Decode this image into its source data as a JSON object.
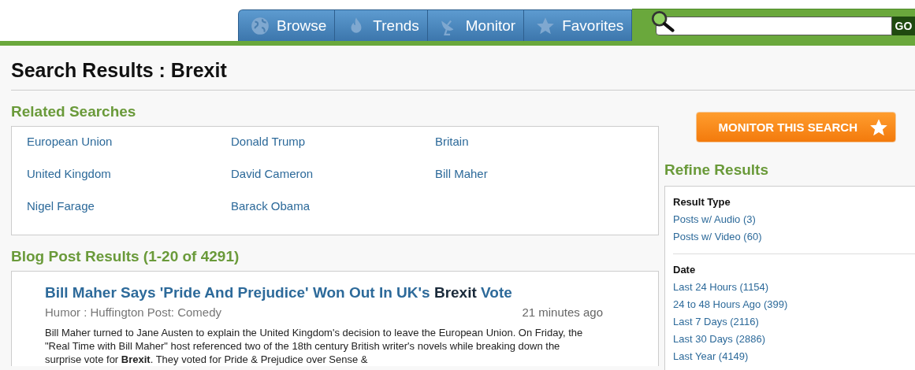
{
  "nav": {
    "tabs": [
      {
        "label": "Browse"
      },
      {
        "label": "Trends"
      },
      {
        "label": "Monitor"
      },
      {
        "label": "Favorites"
      }
    ],
    "search": {
      "button": "GO"
    }
  },
  "page_title": "Search Results : Brexit",
  "related": {
    "heading": "Related Searches",
    "items": [
      "European Union",
      "Donald Trump",
      "Britain",
      "United Kingdom",
      "David Cameron",
      "Bill Maher",
      "Nigel Farage",
      "Barack Obama"
    ]
  },
  "results": {
    "heading": "Blog Post Results (1-20 of 4291)",
    "posts": [
      {
        "title": "Bill Maher Says 'Pride And Prejudice' Won Out In UK's **Brexit** Vote",
        "source": "Humor : Huffington Post: Comedy",
        "time": "21 minutes ago",
        "excerpt": "Bill Maher turned to Jane Austen to explain the United Kingdom's decision to leave the European Union. On Friday, the \"Real Time with Bill Maher\" host referenced two of the 18th century British writer's novels while breaking down the surprise vote for **Brexit**. They voted for Pride & Prejudice over Sense &"
      }
    ]
  },
  "monitor_button": "MONITOR THIS SEARCH",
  "refine": {
    "heading": "Refine Results",
    "groups": [
      {
        "title": "Result Type",
        "links": [
          "Posts w/ Audio (3)",
          "Posts w/ Video (60)"
        ]
      },
      {
        "title": "Date",
        "links": [
          "Last 24 Hours (1154)",
          "24 to 48 Hours Ago (399)",
          "Last 7 Days (2116)",
          "Last 30 Days (2886)",
          "Last Year (4149)"
        ]
      }
    ]
  }
}
